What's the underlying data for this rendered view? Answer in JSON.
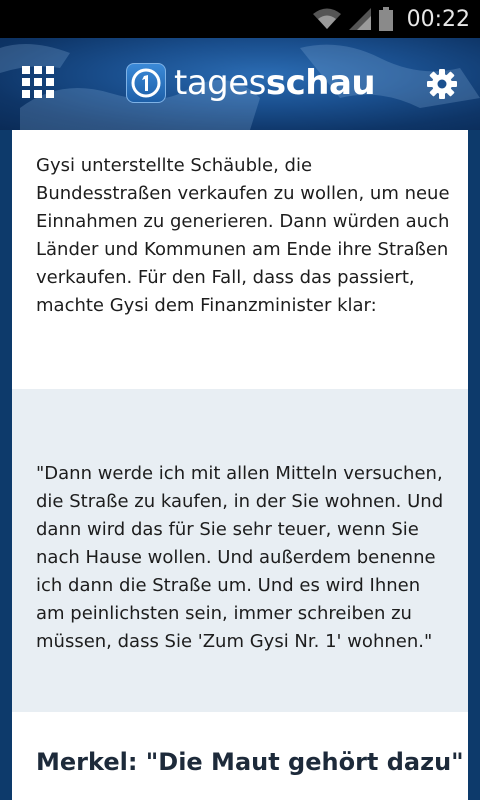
{
  "status_bar": {
    "time": "00:22",
    "icons": [
      "wifi-icon",
      "signal-icon",
      "battery-icon"
    ]
  },
  "header": {
    "logo_text_light": "tages",
    "logo_text_bold": "schau",
    "logo_icon": "tagesschau-logo-icon",
    "menu_icon": "grid-menu-icon",
    "settings_icon": "gear-icon"
  },
  "article": {
    "paragraph": "Gysi unterstellte Schäuble, die Bundesstraßen verkaufen zu wollen, um neue Einnahmen zu generieren. Dann würden auch Länder und Kommunen am Ende ihre Straßen verkaufen. Für den Fall, dass das passiert, machte Gysi dem Finanzminister klar:",
    "quote": "\"Dann werde ich mit allen Mitteln versuchen, die Straße zu kaufen, in der Sie wohnen. Und dann wird das für Sie sehr teuer, wenn Sie nach Hause wollen. Und außerdem benenne ich dann die Straße um. Und es wird Ihnen am peinlichsten sein, immer schreiben zu müssen, dass Sie 'Zum Gysi Nr. 1' wohnen.\"",
    "subheading": "Merkel: \"Die Maut gehört dazu\""
  },
  "colors": {
    "header_blue": "#1a4f8e",
    "quote_background": "#e8eef3",
    "text": "#1d1d1d"
  }
}
